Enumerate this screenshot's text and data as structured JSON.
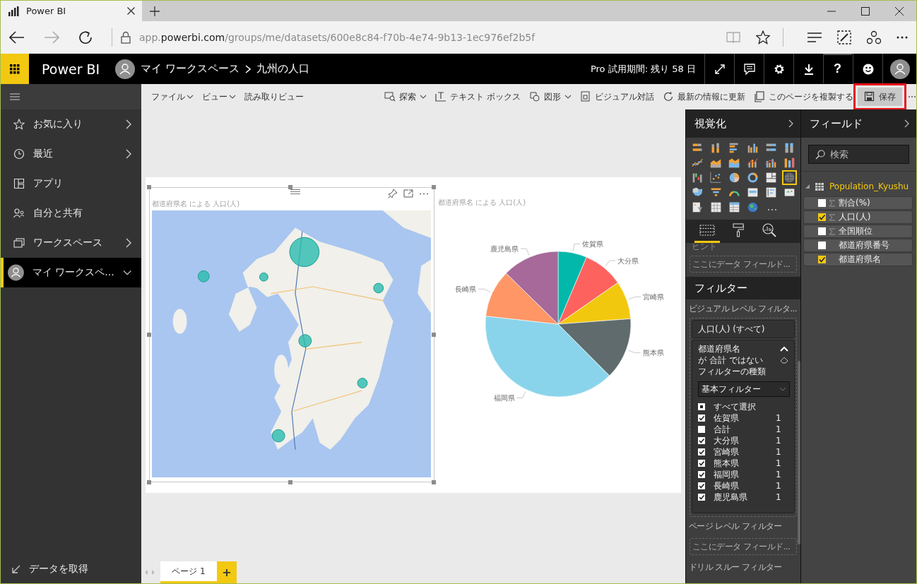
{
  "browser": {
    "tab": {
      "title": "Power BI"
    },
    "url_parts": [
      {
        "text": "app.",
        "emphasis": false
      },
      {
        "text": "powerbi.com",
        "emphasis": true
      },
      {
        "text": "/groups/me/datasets/600e8c84-f70b-4e74-9b13-1ec976ef2b5f",
        "emphasis": false
      }
    ]
  },
  "header": {
    "app_name": "Power BI",
    "breadcrumb": [
      "マイ ワークスペース",
      "九州の人口"
    ],
    "trial": "Pro 試用期間: 残り 58 日",
    "icon_buttons": [
      {
        "kind": "expand"
      },
      {
        "kind": "comment"
      },
      {
        "kind": "settings"
      },
      {
        "kind": "download"
      },
      {
        "kind": "help",
        "text": "?"
      },
      {
        "kind": "smiley"
      },
      {
        "kind": "avatar"
      }
    ]
  },
  "nav": {
    "items": [
      {
        "label": "お気に入り",
        "kind": "star",
        "expandable": true,
        "selected": false
      },
      {
        "label": "最近",
        "kind": "clock",
        "expandable": true,
        "selected": false
      },
      {
        "label": "アプリ",
        "kind": "apps",
        "expandable": false,
        "selected": false
      },
      {
        "label": "自分と共有",
        "kind": "share",
        "expandable": false,
        "selected": false
      },
      {
        "label": "ワークスペース",
        "kind": "workspace",
        "expandable": true,
        "selected": false
      },
      {
        "label": "マイ ワークスペ...",
        "kind": "avatar",
        "expandable": true,
        "selected": true
      }
    ],
    "footer": {
      "label": "データを取得"
    }
  },
  "toolbar": {
    "menus": [
      {
        "label": "ファイル",
        "dropdown": true
      },
      {
        "label": "ビュー",
        "dropdown": true
      },
      {
        "label": "読み取りビュー",
        "dropdown": false
      }
    ],
    "actions": [
      {
        "kind": "explore",
        "label": "探索",
        "dropdown": true,
        "highlighted": false
      },
      {
        "kind": "textbox",
        "label": "テキスト ボックス",
        "dropdown": false,
        "highlighted": false
      },
      {
        "kind": "shapes",
        "label": "図形",
        "dropdown": true,
        "highlighted": false
      },
      {
        "kind": "qna",
        "label": "ビジュアル対話",
        "dropdown": false,
        "highlighted": false
      },
      {
        "kind": "refresh",
        "label": "最新の情報に更新",
        "dropdown": false,
        "highlighted": false
      },
      {
        "kind": "duplicate",
        "label": "このページを複製する",
        "dropdown": false,
        "highlighted": false
      },
      {
        "kind": "save",
        "label": "保存",
        "dropdown": false,
        "highlighted": true
      }
    ]
  },
  "report": {
    "visuals": [
      {
        "kind": "map",
        "title": "都道府県名 による 人口(人)",
        "selected": true
      },
      {
        "kind": "pie",
        "selected": false,
        "chart_data": {
          "type": "pie",
          "title": "都道府県名 による 人口(人)",
          "categories": [
            "佐賀県",
            "大分県",
            "宮崎県",
            "熊本県",
            "福岡県",
            "長崎県",
            "鹿児島県"
          ],
          "values": [
            6.39,
            8.96,
            8.48,
            13.72,
            39.21,
            10.58,
            12.66
          ]
        }
      }
    ],
    "pages": [
      {
        "label": "ページ 1",
        "selected": true
      }
    ],
    "add_page": "+"
  },
  "visualizations": {
    "title": "視覚化",
    "types": [
      {
        "kind": "stacked-bar",
        "selected": false
      },
      {
        "kind": "stacked-column",
        "selected": false
      },
      {
        "kind": "clustered-bar",
        "selected": false
      },
      {
        "kind": "clustered-column",
        "selected": false
      },
      {
        "kind": "bar-100",
        "selected": false
      },
      {
        "kind": "column-100",
        "selected": false
      },
      {
        "kind": "line",
        "selected": false
      },
      {
        "kind": "area",
        "selected": false
      },
      {
        "kind": "stacked-area",
        "selected": false
      },
      {
        "kind": "line-column",
        "selected": false
      },
      {
        "kind": "line-clustered",
        "selected": false
      },
      {
        "kind": "ribbon",
        "selected": false
      },
      {
        "kind": "waterfall",
        "selected": false
      },
      {
        "kind": "scatter",
        "selected": false
      },
      {
        "kind": "pie",
        "selected": false
      },
      {
        "kind": "donut",
        "selected": false
      },
      {
        "kind": "treemap",
        "selected": false
      },
      {
        "kind": "map",
        "selected": true
      },
      {
        "kind": "filled-map",
        "selected": false
      },
      {
        "kind": "funnel",
        "selected": false
      },
      {
        "kind": "gauge",
        "selected": false
      },
      {
        "kind": "card",
        "selected": false
      },
      {
        "kind": "multi-card",
        "selected": false
      },
      {
        "kind": "kpi",
        "selected": false
      },
      {
        "kind": "slicer",
        "selected": false
      },
      {
        "kind": "table",
        "selected": false
      },
      {
        "kind": "matrix",
        "selected": false
      },
      {
        "kind": "globe",
        "selected": false
      }
    ],
    "pane_tabs": [
      {
        "kind": "fields",
        "selected": true
      },
      {
        "kind": "format",
        "selected": false
      },
      {
        "kind": "analytics",
        "selected": false
      }
    ],
    "well": {
      "label": "ヒント",
      "placeholder": "ここにデータ フィールド..."
    }
  },
  "filters": {
    "title": "フィルター",
    "visual_level": {
      "label": "ビジュアル レベル フィルタ...",
      "cards": [
        {
          "title": "人口(人) (すべて)",
          "expanded": false
        },
        {
          "title": "都道府県名",
          "expanded": true,
          "condition": "が 合計 ではない",
          "type_label": "フィルターの種類",
          "filter_type": "基本フィルター",
          "options": [
            {
              "label": "すべて選択",
              "kind": "select-all",
              "partial": true
            },
            {
              "label": "佐賀県",
              "kind": "value",
              "count": "1",
              "checked": true
            },
            {
              "label": "合計",
              "kind": "value",
              "count": "1",
              "checked": false
            },
            {
              "label": "大分県",
              "kind": "value",
              "count": "1",
              "checked": true
            },
            {
              "label": "宮崎県",
              "kind": "value",
              "count": "1",
              "checked": true
            },
            {
              "label": "熊本県",
              "kind": "value",
              "count": "1",
              "checked": true
            },
            {
              "label": "福岡県",
              "kind": "value",
              "count": "1",
              "checked": true
            },
            {
              "label": "長崎県",
              "kind": "value",
              "count": "1",
              "checked": true
            },
            {
              "label": "鹿児島県",
              "kind": "value",
              "count": "1",
              "checked": true
            }
          ]
        }
      ]
    },
    "page_level": {
      "label": "ページ レベル フィルター",
      "placeholder": "ここにデータ フィールド..."
    },
    "drillthrough": {
      "label": "ドリル スルー フィルター"
    }
  },
  "fields": {
    "title": "フィールド",
    "search": {
      "placeholder": "検索"
    },
    "tables": [
      {
        "name": "Population_Kyushu",
        "expanded": true,
        "fields": [
          {
            "name": "割合(%)",
            "kind": "measure",
            "checked": false
          },
          {
            "name": "人口(人)",
            "kind": "measure",
            "checked": true
          },
          {
            "name": "全国順位",
            "kind": "measure",
            "checked": false
          },
          {
            "name": "都道府県番号",
            "kind": "attribute",
            "checked": false
          },
          {
            "name": "都道府県名",
            "kind": "attribute",
            "checked": true
          }
        ]
      }
    ]
  }
}
